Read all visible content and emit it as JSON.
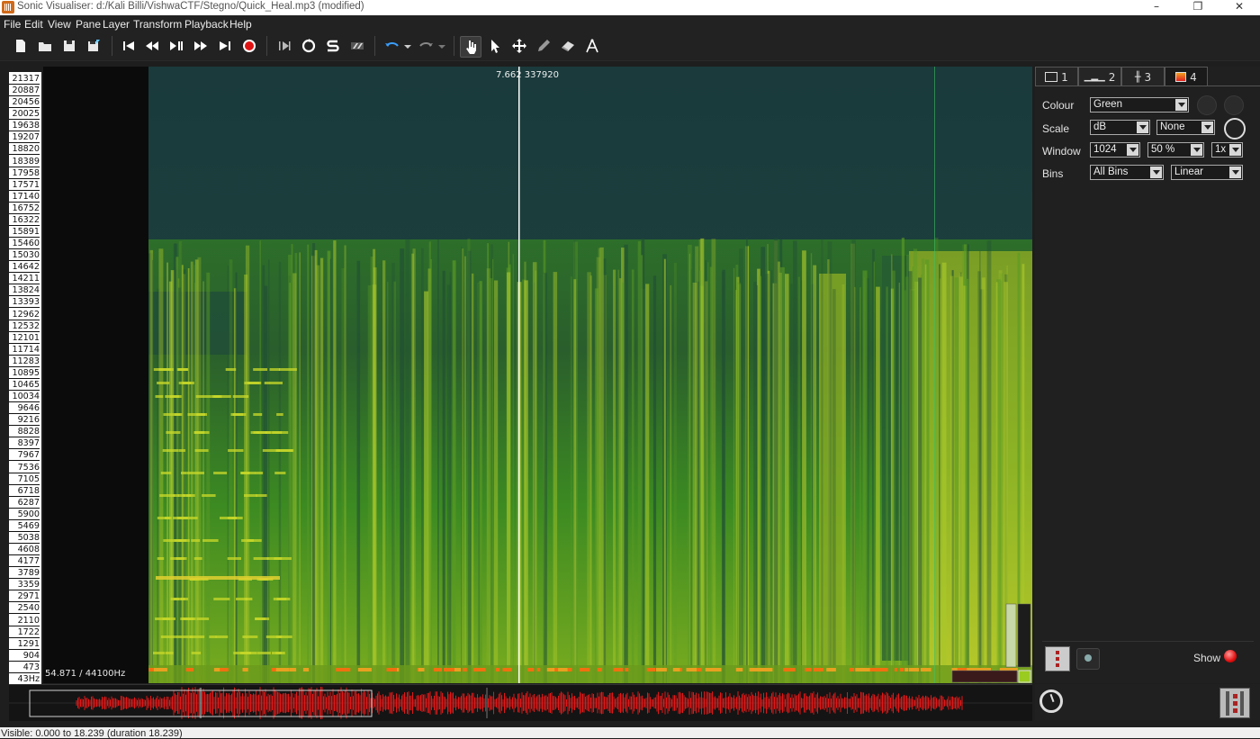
{
  "window": {
    "title": "Sonic Visualiser: d:/Kali Billi/VishwaCTF/Stegno/Quick_Heal.mp3 (modified)",
    "minimize_glyph": "–",
    "maximize_glyph": "❐",
    "close_glyph": "✕"
  },
  "menu": [
    "File",
    "Edit",
    "View",
    "Pane",
    "Layer",
    "Transform",
    "Playback",
    "Help"
  ],
  "toolbar": {
    "icons": [
      "new-file-icon",
      "open-folder-icon",
      "save-icon",
      "save-as-icon",
      "rewind-start-icon",
      "rewind-icon",
      "play-pause-icon",
      "fast-forward-icon",
      "fast-forward-end-icon",
      "record-icon",
      "play-selection-icon",
      "loop-icon",
      "solo-icon",
      "follow-playback-icon",
      "undo-icon",
      "redo-icon",
      "navigate-tool-icon",
      "select-tool-icon",
      "move-tool-icon",
      "draw-tool-icon",
      "erase-tool-icon",
      "measure-tool-icon"
    ]
  },
  "frequency_ruler": {
    "labels": [
      "21317",
      "20887",
      "20456",
      "20025",
      "19638",
      "19207",
      "18820",
      "18389",
      "17958",
      "17571",
      "17140",
      "16752",
      "16322",
      "15891",
      "15460",
      "15030",
      "14642",
      "14211",
      "13824",
      "13393",
      "12962",
      "12532",
      "12101",
      "11714",
      "11283",
      "10895",
      "10465",
      "10034",
      "9646",
      "9216",
      "8828",
      "8397",
      "7967",
      "7536",
      "7105",
      "6718",
      "6287",
      "5900",
      "5469",
      "5038",
      "4608",
      "4177",
      "3789",
      "3359",
      "2971",
      "2540",
      "2110",
      "1722",
      "1291",
      "904",
      "473",
      "43Hz"
    ]
  },
  "pane": {
    "hover_readout": "54.871 / 44100Hz",
    "playhead_label": "7.662  337920",
    "playhead_fraction": 0.42
  },
  "properties": {
    "tabs": [
      {
        "label": "1",
        "icon": "pane-icon"
      },
      {
        "label": "2",
        "icon": "ruler-icon"
      },
      {
        "label": "3",
        "icon": "waveform-icon"
      },
      {
        "label": "4",
        "icon": "spectrogram-icon"
      }
    ],
    "active_tab": "4",
    "colour_label": "Colour",
    "colour_value": "Green",
    "scale_label": "Scale",
    "scale_value": "dB",
    "normalize_value": "None",
    "window_label": "Window",
    "window_size": "1024",
    "window_overlap": "50 %",
    "window_oversample": "1x",
    "bins_label": "Bins",
    "bins_value": "All Bins",
    "bins_scale": "Linear",
    "show_label": "Show"
  },
  "status": {
    "text": "Visible: 0.000 to 18.239 (duration 18.239)"
  },
  "colors": {
    "waveform": "#e01818",
    "spectrogram_top": "#1b3d3b",
    "spectrogram_mid": "#2e7a1e",
    "spectrogram_bright": "#b8d02a"
  }
}
